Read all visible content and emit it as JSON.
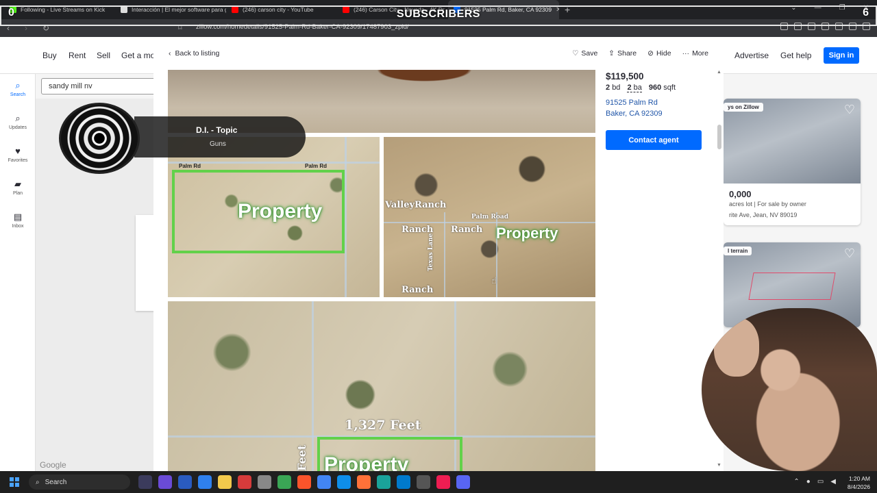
{
  "overlay": {
    "left_count": "0",
    "title": "SUBSCRIBERS",
    "right_count": "6"
  },
  "browser": {
    "tabs": [
      {
        "label": "Following - Live Streams on Kick",
        "color": "#53fc18"
      },
      {
        "label": "Interacción | El mejor software para g",
        "color": "#dddddd"
      },
      {
        "label": "(246) carson city - YouTube",
        "color": "#ff0000"
      },
      {
        "label": "(246) Carson City - Nevada - 4K Dr",
        "color": "#ff0000"
      },
      {
        "label": "91525 Palm Rd, Baker, CA 92309",
        "color": "#006aff"
      }
    ],
    "url": "zillow.com/homedetails/91525-Palm-Rd-Baker-CA-92309/17487903_zpid/"
  },
  "zillow": {
    "nav": {
      "buy": "Buy",
      "rent": "Rent",
      "sell": "Sell",
      "get_a_mortgage": "Get a mo",
      "advertise": "Advertise",
      "get_help": "Get help",
      "sign_in": "Sign in"
    },
    "sidebar": [
      {
        "label": "Search"
      },
      {
        "label": "Updates"
      },
      {
        "label": "Favorites"
      },
      {
        "label": "Plan"
      },
      {
        "label": "Inbox"
      }
    ],
    "search_value": "sandy mill nv",
    "map_attribution": "Google",
    "right_cards": [
      {
        "badge": "ys on Zillow",
        "price": "0,000",
        "meta": "acres lot | For sale by owner",
        "addr": "rite Ave, Jean, NV 89019"
      },
      {
        "badge": "l terrain"
      }
    ]
  },
  "modal": {
    "back": "Back to listing",
    "actions": {
      "save": "Save",
      "share": "Share",
      "hide": "Hide",
      "more": "More"
    },
    "price": "$119,500",
    "beds_num": "2",
    "beds_unit": "bd",
    "baths_num": "2",
    "baths_unit": "ba",
    "sqft_num": "960",
    "sqft_unit": "sqft",
    "address_line1": "91525 Palm Rd",
    "address_line2": "Baker, CA 92309",
    "contact": "Contact agent",
    "photo_labels": {
      "palm_rd": "Palm Rd",
      "property": "Property",
      "valley_ranch": "ValleyRanch",
      "palm_road": "Palm Road",
      "ranch": "Ranch",
      "texas_lane": "Texas Lane",
      "feet": "1,327 Feet",
      "feet_vertical": "Feet"
    }
  },
  "music_overlay": {
    "title": "D.I. - Topic",
    "subtitle": "Guns"
  },
  "taskbar": {
    "search": "Search",
    "time": "1:20 AM",
    "date": "8/4/2026"
  }
}
